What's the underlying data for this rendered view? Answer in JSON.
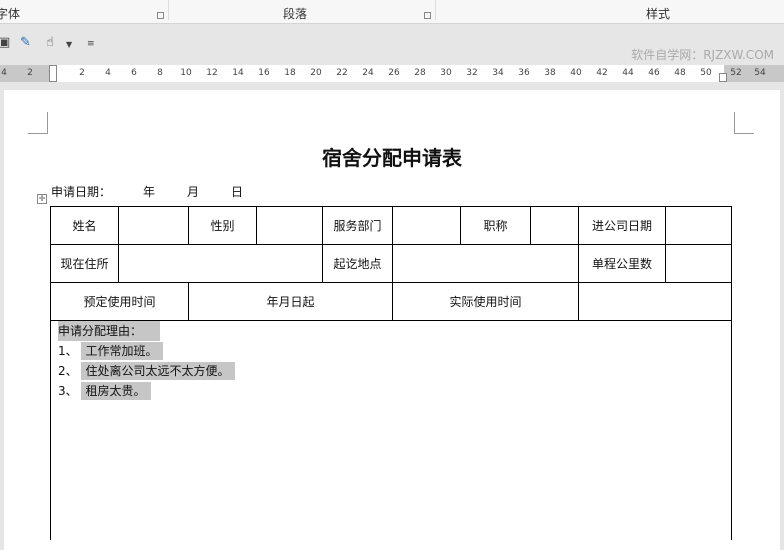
{
  "ribbon": {
    "groups": [
      "字体",
      "段落",
      "样式"
    ]
  },
  "toolbar": {
    "watermark": "软件自学网：RJZXW.COM"
  },
  "ruler": {
    "left_ticks": [
      "4",
      "2"
    ],
    "ticks": [
      "2",
      "4",
      "6",
      "8",
      "10",
      "12",
      "14",
      "16",
      "18",
      "20",
      "22",
      "24",
      "26",
      "28",
      "30",
      "32",
      "34",
      "36",
      "38",
      "40",
      "42",
      "44",
      "46",
      "48",
      "50"
    ],
    "right_ticks": [
      "52",
      "54"
    ]
  },
  "doc": {
    "title": "宿舍分配申请表",
    "date": {
      "label": "申请日期：",
      "year": "年",
      "month": "月",
      "day": "日"
    },
    "table": {
      "row1": [
        "姓名",
        "",
        "性别",
        "",
        "服务部门",
        "",
        "职称",
        "",
        "进公司日期",
        ""
      ],
      "row2": [
        "现在住所",
        "",
        "起讫地点",
        "",
        "单程公里数",
        ""
      ],
      "row3": [
        "预定使用时间",
        "年月日起",
        "实际使用时间",
        ""
      ]
    },
    "reason": {
      "heading": "申请分配理由：",
      "items": [
        {
          "num": "1、",
          "text": "工作常加班。"
        },
        {
          "num": "2、",
          "text": "住处离公司太远不太方便。"
        },
        {
          "num": "3、",
          "text": "租房太贵。"
        }
      ]
    }
  }
}
